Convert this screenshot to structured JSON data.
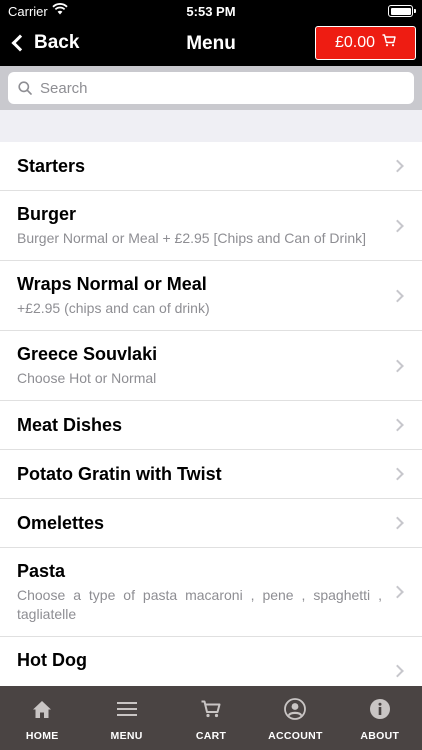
{
  "status_bar": {
    "carrier": "Carrier",
    "time": "5:53 PM"
  },
  "nav": {
    "back_label": "Back",
    "title": "Menu",
    "cart_total": "£0.00"
  },
  "search": {
    "placeholder": "Search"
  },
  "menu_items": [
    {
      "name": "Starters",
      "description": ""
    },
    {
      "name": "Burger",
      "description": "Burger Normal or Meal + £2.95 [Chips and Can of Drink]"
    },
    {
      "name": "Wraps Normal or Meal",
      "description": "+£2.95 (chips and can of drink)"
    },
    {
      "name": "Greece Souvlaki",
      "description": "Choose Hot or Normal"
    },
    {
      "name": "Meat Dishes",
      "description": ""
    },
    {
      "name": "Potato Gratin with Twist",
      "description": ""
    },
    {
      "name": "Omelettes",
      "description": ""
    },
    {
      "name": "Pasta",
      "description": "Choose a type of pasta macaroni , pene , spaghetti , tagliatelle"
    },
    {
      "name": "Hot Dog",
      "description": ""
    }
  ],
  "tabs": [
    {
      "label": "HOME",
      "icon": "home-icon"
    },
    {
      "label": "MENU",
      "icon": "menu-icon"
    },
    {
      "label": "CART",
      "icon": "cart-icon"
    },
    {
      "label": "ACCOUNT",
      "icon": "account-icon"
    },
    {
      "label": "ABOUT",
      "icon": "info-icon"
    }
  ],
  "colors": {
    "nav_bg": "#000000",
    "cart_button": "#ee1c12",
    "tab_bar_bg": "#4a4443",
    "search_bar_bg": "#c9c9ce",
    "description_text": "#8e8e93"
  }
}
